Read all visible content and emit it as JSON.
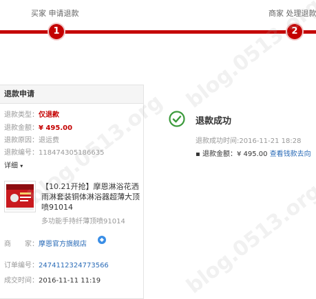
{
  "progress": {
    "steps": [
      {
        "number": "1",
        "label": "买家 申请退款"
      },
      {
        "number": "2",
        "label": "商家 处理退款"
      }
    ],
    "color": "#c40000"
  },
  "refund_panel": {
    "title": "退款申请",
    "fields": [
      {
        "label": "退款类型：",
        "value": "仅退款"
      },
      {
        "label": "退款金额：",
        "value": "¥ 495.00"
      },
      {
        "label": "退款原因：",
        "value": "退运费"
      },
      {
        "label": "退款编号：",
        "value": "118474305186635"
      }
    ],
    "details_link": "详细",
    "product": {
      "title": "【10.21开抢】摩恩淋浴花洒雨淋套装铜体淋浴器超薄大顶喷91014",
      "subtitle": "多功能手持纤薄顶喷91014"
    },
    "seller": {
      "label": "商　　家：",
      "value": "摩恩官方旗舰店",
      "icon": "chat-icon"
    },
    "order_no": {
      "label": "订单编号：",
      "value": "2474112324773566"
    },
    "deal_time": {
      "label": "成交时间：",
      "value": "2016-11-11 11:19"
    }
  },
  "status": {
    "icon": "check-circle-icon",
    "title": "退款成功",
    "time_label": "退款成功时间:",
    "time_value": "2016-11-21 18:28",
    "amount_label": "退款金额：",
    "amount_value": "¥ 495.00",
    "link_text": "查看钱款去向"
  },
  "watermark": "blog.0513.org",
  "colors": {
    "accent": "#c40000",
    "link": "#2a6bb7",
    "success": "#3b9a3b"
  }
}
